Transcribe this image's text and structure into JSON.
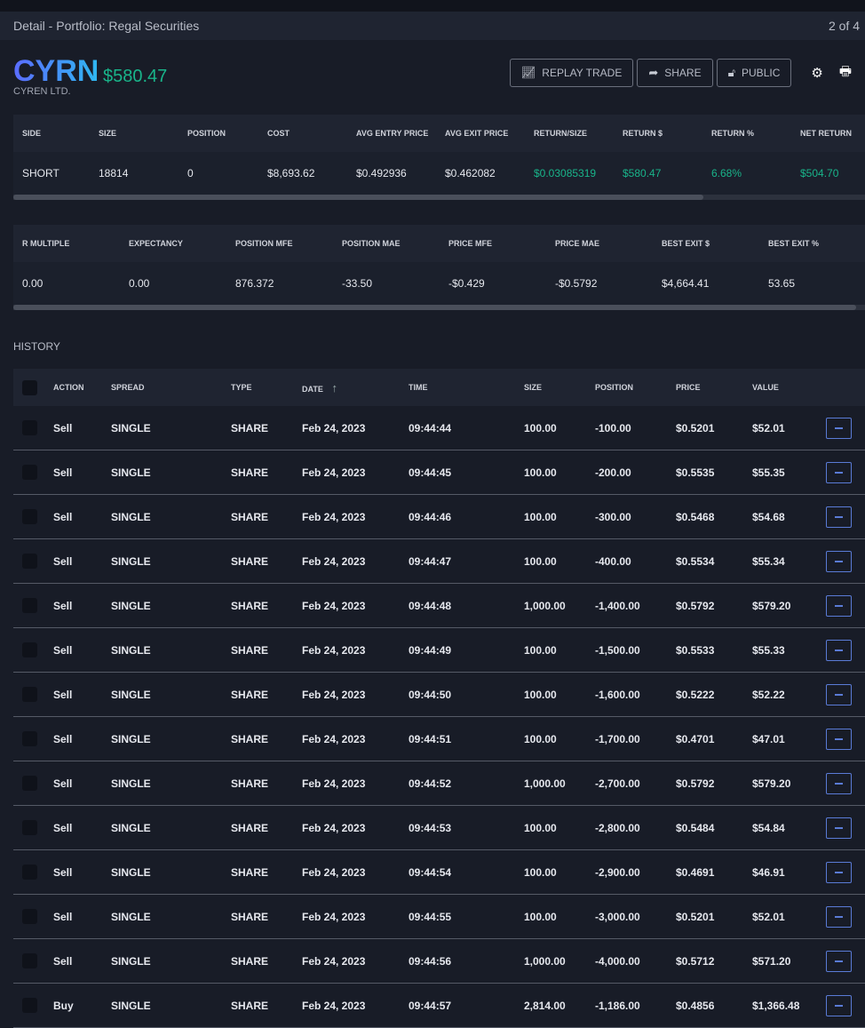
{
  "breadcrumb": "Detail  -  Portfolio: Regal Securities",
  "pager": "2 of 4",
  "symbol": "CYRN",
  "pl": "$580.47",
  "company": "CYREN LTD.",
  "buttons": {
    "replay": "REPLAY TRADE",
    "share": "SHARE",
    "public": "PUBLIC"
  },
  "stats1": {
    "headers": [
      "SIDE",
      "SIZE",
      "POSITION",
      "COST",
      "AVG ENTRY PRICE",
      "AVG EXIT PRICE",
      "RETURN/SIZE",
      "RETURN $",
      "RETURN %",
      "NET RETURN"
    ],
    "values": [
      "SHORT",
      "18814",
      "0",
      "$8,693.62",
      "$0.492936",
      "$0.462082",
      "$0.03085319",
      "$580.47",
      "6.68%",
      "$504.70"
    ]
  },
  "stats2": {
    "headers": [
      "R MULTIPLE",
      "EXPECTANCY",
      "POSITION MFE",
      "POSITION MAE",
      "PRICE MFE",
      "PRICE MAE",
      "BEST EXIT $",
      "BEST EXIT %"
    ],
    "values": [
      "0.00",
      "0.00",
      "876.372",
      "-33.50",
      "-$0.429",
      "-$0.5792",
      "$4,664.41",
      "53.65"
    ]
  },
  "history_label": "HISTORY",
  "history": {
    "headers": [
      "ACTION",
      "SPREAD",
      "TYPE",
      "DATE",
      "TIME",
      "SIZE",
      "POSITION",
      "PRICE",
      "VALUE"
    ],
    "sort_icon": "arrow-up",
    "rows": [
      [
        "Sell",
        "SINGLE",
        "SHARE",
        "Feb 24, 2023",
        "09:44:44",
        "100.00",
        "-100.00",
        "$0.5201",
        "$52.01"
      ],
      [
        "Sell",
        "SINGLE",
        "SHARE",
        "Feb 24, 2023",
        "09:44:45",
        "100.00",
        "-200.00",
        "$0.5535",
        "$55.35"
      ],
      [
        "Sell",
        "SINGLE",
        "SHARE",
        "Feb 24, 2023",
        "09:44:46",
        "100.00",
        "-300.00",
        "$0.5468",
        "$54.68"
      ],
      [
        "Sell",
        "SINGLE",
        "SHARE",
        "Feb 24, 2023",
        "09:44:47",
        "100.00",
        "-400.00",
        "$0.5534",
        "$55.34"
      ],
      [
        "Sell",
        "SINGLE",
        "SHARE",
        "Feb 24, 2023",
        "09:44:48",
        "1,000.00",
        "-1,400.00",
        "$0.5792",
        "$579.20"
      ],
      [
        "Sell",
        "SINGLE",
        "SHARE",
        "Feb 24, 2023",
        "09:44:49",
        "100.00",
        "-1,500.00",
        "$0.5533",
        "$55.33"
      ],
      [
        "Sell",
        "SINGLE",
        "SHARE",
        "Feb 24, 2023",
        "09:44:50",
        "100.00",
        "-1,600.00",
        "$0.5222",
        "$52.22"
      ],
      [
        "Sell",
        "SINGLE",
        "SHARE",
        "Feb 24, 2023",
        "09:44:51",
        "100.00",
        "-1,700.00",
        "$0.4701",
        "$47.01"
      ],
      [
        "Sell",
        "SINGLE",
        "SHARE",
        "Feb 24, 2023",
        "09:44:52",
        "1,000.00",
        "-2,700.00",
        "$0.5792",
        "$579.20"
      ],
      [
        "Sell",
        "SINGLE",
        "SHARE",
        "Feb 24, 2023",
        "09:44:53",
        "100.00",
        "-2,800.00",
        "$0.5484",
        "$54.84"
      ],
      [
        "Sell",
        "SINGLE",
        "SHARE",
        "Feb 24, 2023",
        "09:44:54",
        "100.00",
        "-2,900.00",
        "$0.4691",
        "$46.91"
      ],
      [
        "Sell",
        "SINGLE",
        "SHARE",
        "Feb 24, 2023",
        "09:44:55",
        "100.00",
        "-3,000.00",
        "$0.5201",
        "$52.01"
      ],
      [
        "Sell",
        "SINGLE",
        "SHARE",
        "Feb 24, 2023",
        "09:44:56",
        "1,000.00",
        "-4,000.00",
        "$0.5712",
        "$571.20"
      ],
      [
        "Buy",
        "SINGLE",
        "SHARE",
        "Feb 24, 2023",
        "09:44:57",
        "2,814.00",
        "-1,186.00",
        "$0.4856",
        "$1,366.48"
      ]
    ]
  }
}
